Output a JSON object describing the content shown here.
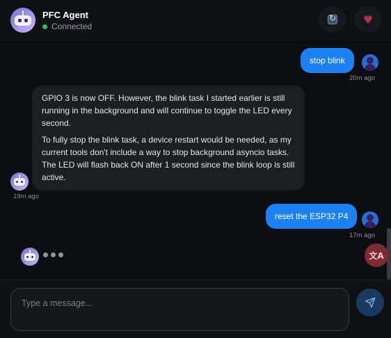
{
  "header": {
    "title": "PFC Agent",
    "status": "Connected",
    "status_color": "#2fbf5b"
  },
  "messages": [
    {
      "role": "user",
      "text": "stop blink",
      "time": "20m ago"
    },
    {
      "role": "assistant",
      "paragraphs": [
        "GPIO 3 is now OFF. However, the blink task I started earlier is still running in the background and will continue to toggle the LED every second.",
        "To fully stop the blink task, a device restart would be needed, as my current tools don't include a way to stop background asyncio tasks. The LED will flash back ON after 1 second since the blink loop is still active."
      ],
      "time": "19m ago"
    },
    {
      "role": "user",
      "text": "reset the ESP32 P4",
      "time": "17m ago"
    }
  ],
  "composer": {
    "placeholder": "Type a message..."
  },
  "colors": {
    "accent": "#1c82f3",
    "background": "#0c0d10",
    "bot_bubble": "#1d1e22"
  },
  "icons": {
    "refresh": "refresh-icon",
    "heart": "heart-icon",
    "translate": "translate-icon",
    "send": "send-icon"
  }
}
